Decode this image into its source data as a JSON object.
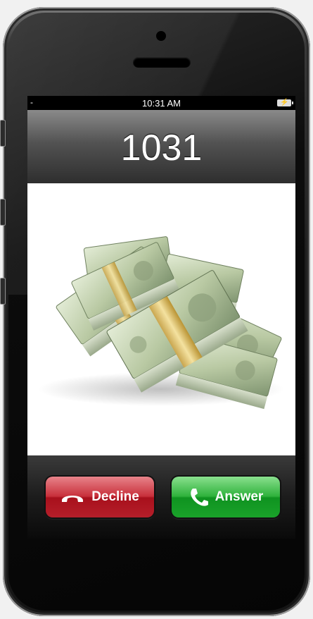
{
  "status_bar": {
    "signal_text": "-",
    "time": "10:31 AM",
    "battery_icon": "battery-charging-icon"
  },
  "caller": {
    "number": "1031",
    "photo": "stacks-of-money-image"
  },
  "actions": {
    "decline_label": "Decline",
    "answer_label": "Answer",
    "decline_icon": "phone-hangup-icon",
    "answer_icon": "phone-handset-icon",
    "decline_color": "#c8303b",
    "answer_color": "#2fb23c"
  }
}
